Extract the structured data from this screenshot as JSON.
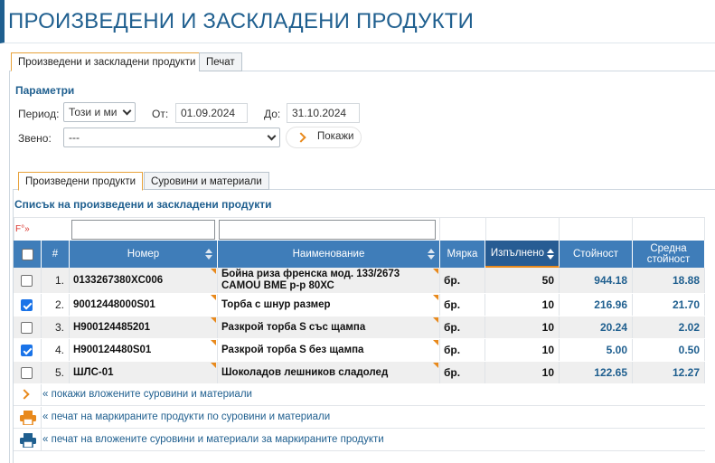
{
  "page": {
    "title": "ПРОИЗВЕДЕНИ И ЗАСКЛАДЕНИ ПРОДУКТИ"
  },
  "tabs": [
    {
      "label": "Произведени и заскладени продукти",
      "active": true
    },
    {
      "label": "Печат",
      "active": false
    }
  ],
  "params": {
    "title": "Параметри",
    "period_label": "Период:",
    "period_value": "Този и ми",
    "from_label": "От:",
    "from_value": "01.09.2024",
    "to_label": "До:",
    "to_value": "31.10.2024",
    "unit_label": "Звено:",
    "unit_value": "---",
    "show_button": "Покажи"
  },
  "subtabs": [
    {
      "label": "Произведени продукти",
      "active": true
    },
    {
      "label": "Суровини и материали",
      "active": false
    }
  ],
  "list": {
    "title": "Списък на произведени и заскладени продукти",
    "filter_marker": "F°»",
    "columns": {
      "index": "#",
      "number": "Номер",
      "name": "Наименование",
      "unit": "Мярка",
      "done": "Изпълнено",
      "value": "Стойност",
      "avg_value": "Средна стойност"
    },
    "rows": [
      {
        "index": "1.",
        "number": "0133267380XC006",
        "name": "Бойна риза френска мод. 133/2673 CAMOU ВМЕ р-р 80ХС",
        "unit": "бр.",
        "done": "50",
        "value": "944.18",
        "avg": "18.88",
        "checked": false
      },
      {
        "index": "2.",
        "number": "90012448000S01",
        "name": "Торба с шнур размер",
        "unit": "бр.",
        "done": "10",
        "value": "216.96",
        "avg": "21.70",
        "checked": true
      },
      {
        "index": "3.",
        "number": "H900124485201",
        "name": "Разкрой торба S със щампа",
        "unit": "бр.",
        "done": "10",
        "value": "20.24",
        "avg": "2.02",
        "checked": false
      },
      {
        "index": "4.",
        "number": "H900124480S01",
        "name": "Разкрой торба S без щампа",
        "unit": "бр.",
        "done": "10",
        "value": "5.00",
        "avg": "0.50",
        "checked": true
      },
      {
        "index": "5.",
        "number": "ШЛС-01",
        "name": "Шоколадов лешников сладолед",
        "unit": "бр.",
        "done": "10",
        "value": "122.65",
        "avg": "12.27",
        "checked": false
      }
    ],
    "actions": [
      {
        "icon": "chevron-right-icon",
        "label": "« покажи вложените суровини и материали"
      },
      {
        "icon": "printer-icon",
        "label": "« печат на маркираните продукти по суровини и материали"
      },
      {
        "icon": "printer-icon",
        "label": "« печат на вложените суровини и материали за маркираните продукти"
      }
    ]
  },
  "colors": {
    "accent": "#1f5f8f",
    "header": "#3f7db9",
    "orange": "#e8891c"
  }
}
